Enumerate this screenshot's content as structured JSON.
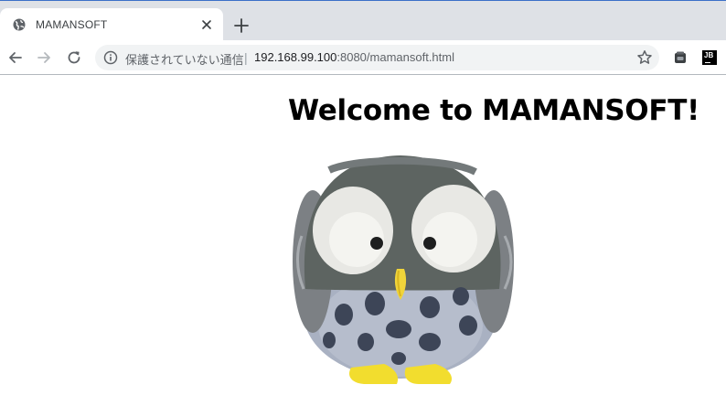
{
  "browser": {
    "tab": {
      "title": "MAMANSOFT"
    },
    "omnibox": {
      "security_text": "保護されていない通信",
      "separator": "|",
      "url_host": "192.168.99.100",
      "url_rest": ":8080/mamansoft.html"
    },
    "extensions": {
      "jb_label": "JB"
    },
    "colors": {
      "tabstrip_bg": "#dee1e6",
      "omnibox_bg": "#f1f3f4",
      "icon_gray": "#5f6368"
    }
  },
  "page": {
    "heading": "Welcome to MAMANSOFT!",
    "image": {
      "subject": "owl-plush-image"
    }
  }
}
